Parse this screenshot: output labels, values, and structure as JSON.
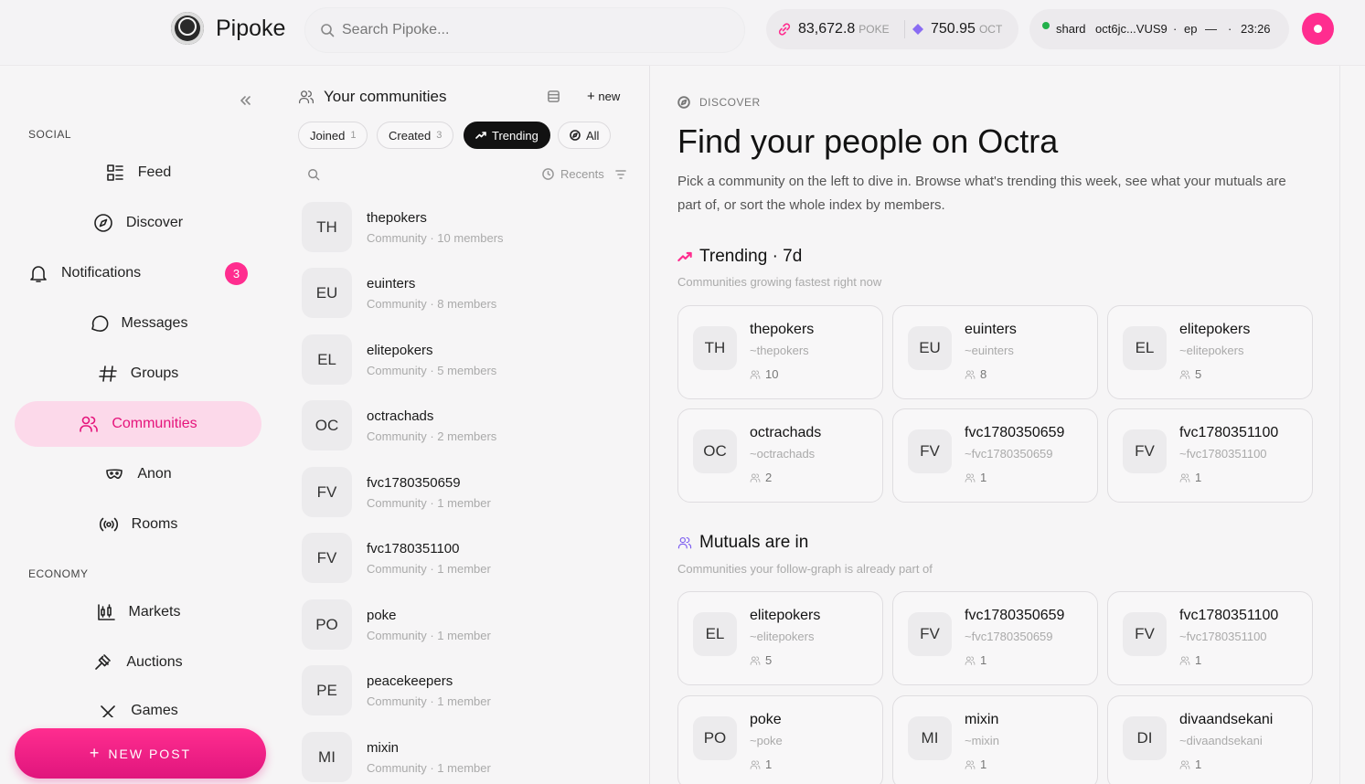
{
  "header": {
    "brand": "Pipoke",
    "search_placeholder": "Search Pipoke...",
    "poke_balance": "83,672.8",
    "poke_unit": "POKE",
    "oct_balance": "750.95",
    "oct_unit": "OCT",
    "shard_label": "shard",
    "shard_id": "oct6jc...VUS9",
    "sep1": "·",
    "ep_label": "ep",
    "ep_value": "—",
    "sep2": "·",
    "time": "23:26",
    "icons": {
      "search": "search-icon",
      "poke": "link-icon",
      "oct": "diamond-icon",
      "theme": "moon-icon"
    },
    "colors": {
      "accent": "#ff2d8f",
      "status": "#22b04a"
    }
  },
  "sidebar": {
    "social_label": "SOCIAL",
    "economy_label": "ECONOMY",
    "items": [
      {
        "label": "Feed",
        "icon": "feed-icon"
      },
      {
        "label": "Discover",
        "icon": "compass-icon"
      },
      {
        "label": "Notifications",
        "icon": "bell-icon",
        "badge": "3"
      },
      {
        "label": "Messages",
        "icon": "message-icon"
      },
      {
        "label": "Groups",
        "icon": "hash-icon"
      },
      {
        "label": "Communities",
        "icon": "users-icon",
        "active": true
      },
      {
        "label": "Anon",
        "icon": "mask-icon"
      },
      {
        "label": "Rooms",
        "icon": "broadcast-icon"
      },
      {
        "label": "Markets",
        "icon": "candlestick-icon"
      },
      {
        "label": "Auctions",
        "icon": "gavel-icon"
      },
      {
        "label": "Games",
        "icon": "games-icon"
      }
    ],
    "new_post": "NEW POST"
  },
  "communities_panel": {
    "title": "Your communities",
    "new_label": "new",
    "chips": [
      {
        "label": "Joined",
        "count": "1"
      },
      {
        "label": "Created",
        "count": "3"
      },
      {
        "label": "Trending",
        "count": ""
      },
      {
        "label": "All",
        "count": ""
      }
    ],
    "sort_label": "Recents",
    "items": [
      {
        "initials": "TH",
        "name": "thepokers",
        "sub": "Community · 10 members"
      },
      {
        "initials": "EU",
        "name": "euinters",
        "sub": "Community · 8 members"
      },
      {
        "initials": "EL",
        "name": "elitepokers",
        "sub": "Community · 5 members"
      },
      {
        "initials": "OC",
        "name": "octrachads",
        "sub": "Community · 2 members"
      },
      {
        "initials": "FV",
        "name": "fvc1780350659",
        "sub": "Community · 1 member"
      },
      {
        "initials": "FV",
        "name": "fvc1780351100",
        "sub": "Community · 1 member"
      },
      {
        "initials": "PO",
        "name": "poke",
        "sub": "Community · 1 member"
      },
      {
        "initials": "PE",
        "name": "peacekeepers",
        "sub": "Community · 1 member"
      },
      {
        "initials": "MI",
        "name": "mixin",
        "sub": "Community · 1 member"
      }
    ]
  },
  "main": {
    "kicker": "DISCOVER",
    "title": "Find your people on Octra",
    "lead": "Pick a community on the left to dive in. Browse what's trending this week, see what your mutuals are part of, or sort the whole index by members.",
    "trending": {
      "title": "Trending · 7d",
      "subtitle": "Communities growing fastest right now",
      "cards": [
        {
          "initials": "TH",
          "name": "thepokers",
          "handle": "~thepokers",
          "members": "10"
        },
        {
          "initials": "EU",
          "name": "euinters",
          "handle": "~euinters",
          "members": "8"
        },
        {
          "initials": "EL",
          "name": "elitepokers",
          "handle": "~elitepokers",
          "members": "5"
        },
        {
          "initials": "OC",
          "name": "octrachads",
          "handle": "~octrachads",
          "members": "2"
        },
        {
          "initials": "FV",
          "name": "fvc1780350659",
          "handle": "~fvc1780350659",
          "members": "1"
        },
        {
          "initials": "FV",
          "name": "fvc1780351100",
          "handle": "~fvc1780351100",
          "members": "1"
        }
      ]
    },
    "mutuals": {
      "title": "Mutuals are in",
      "subtitle": "Communities your follow-graph is already part of",
      "cards": [
        {
          "initials": "EL",
          "name": "elitepokers",
          "handle": "~elitepokers",
          "members": "5"
        },
        {
          "initials": "FV",
          "name": "fvc1780350659",
          "handle": "~fvc1780350659",
          "members": "1"
        },
        {
          "initials": "FV",
          "name": "fvc1780351100",
          "handle": "~fvc1780351100",
          "members": "1"
        },
        {
          "initials": "PO",
          "name": "poke",
          "handle": "~poke",
          "members": "1"
        },
        {
          "initials": "MI",
          "name": "mixin",
          "handle": "~mixin",
          "members": "1"
        },
        {
          "initials": "DI",
          "name": "divaandsekani",
          "handle": "~divaandsekani",
          "members": "1"
        }
      ]
    }
  }
}
